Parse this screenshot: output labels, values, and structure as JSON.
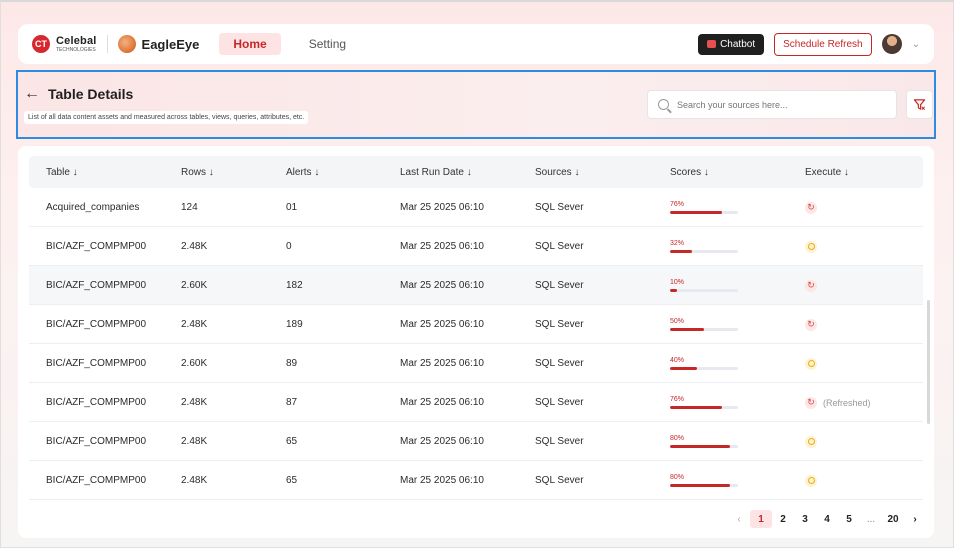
{
  "nav": {
    "brand_name": "Celebal",
    "brand_sub": "TECHNOLOGIES",
    "brand_logo_text": "CT",
    "app_name": "EagleEye",
    "tabs": [
      {
        "label": "Home",
        "active": true
      },
      {
        "label": "Setting",
        "active": false
      }
    ],
    "chatbot_label": "Chatbot",
    "schedule_refresh_label": "Schedule Refresh"
  },
  "header": {
    "title": "Table Details",
    "subtitle": "List of all data content assets and measured across tables, views, queries, attributes, etc.",
    "search_placeholder": "Search your sources here..."
  },
  "table": {
    "columns": [
      "Table ↓",
      "Rows ↓",
      "Alerts ↓",
      "Last Run Date ↓",
      "Sources ↓",
      "Scores ↓",
      "Execute ↓"
    ],
    "rows": [
      {
        "table": "Acquired_companies",
        "rows": "124",
        "alerts": "01",
        "last_run": "Mar 25 2025 06:10",
        "source": "SQL Sever",
        "score_label": "76%",
        "score": 0.76,
        "execute": "refresh",
        "note": ""
      },
      {
        "table": "BIC/AZF_COMPMP00",
        "rows": "2.48K",
        "alerts": "0",
        "last_run": "Mar 25 2025 06:10",
        "source": "SQL Sever",
        "score_label": "32%",
        "score": 0.32,
        "execute": "pending",
        "note": ""
      },
      {
        "table": "BIC/AZF_COMPMP00",
        "rows": "2.60K",
        "alerts": "182",
        "last_run": "Mar 25 2025 06:10",
        "source": "SQL Sever",
        "score_label": "10%",
        "score": 0.1,
        "execute": "refresh",
        "note": ""
      },
      {
        "table": "BIC/AZF_COMPMP00",
        "rows": "2.48K",
        "alerts": "189",
        "last_run": "Mar 25 2025 06:10",
        "source": "SQL Sever",
        "score_label": "50%",
        "score": 0.5,
        "execute": "refresh",
        "note": ""
      },
      {
        "table": "BIC/AZF_COMPMP00",
        "rows": "2.60K",
        "alerts": "89",
        "last_run": "Mar 25 2025 06:10",
        "source": "SQL Sever",
        "score_label": "40%",
        "score": 0.4,
        "execute": "pending",
        "note": ""
      },
      {
        "table": "BIC/AZF_COMPMP00",
        "rows": "2.48K",
        "alerts": "87",
        "last_run": "Mar 25 2025 06:10",
        "source": "SQL Sever",
        "score_label": "76%",
        "score": 0.76,
        "execute": "refresh",
        "note": "(Refreshed)"
      },
      {
        "table": "BIC/AZF_COMPMP00",
        "rows": "2.48K",
        "alerts": "65",
        "last_run": "Mar 25 2025 06:10",
        "source": "SQL Sever",
        "score_label": "80%",
        "score": 0.88,
        "execute": "pending",
        "note": ""
      },
      {
        "table": "BIC/AZF_COMPMP00",
        "rows": "2.48K",
        "alerts": "65",
        "last_run": "Mar 25 2025 06:10",
        "source": "SQL Sever",
        "score_label": "80%",
        "score": 0.88,
        "execute": "pending",
        "note": ""
      }
    ],
    "highlighted_row": 2
  },
  "pagination": {
    "prev": "‹",
    "pages": [
      "1",
      "2",
      "3",
      "4",
      "5",
      "...",
      "20"
    ],
    "active": "1",
    "next": "›"
  },
  "colors": {
    "accent": "#c62828",
    "selection_border": "#2f8be0"
  }
}
